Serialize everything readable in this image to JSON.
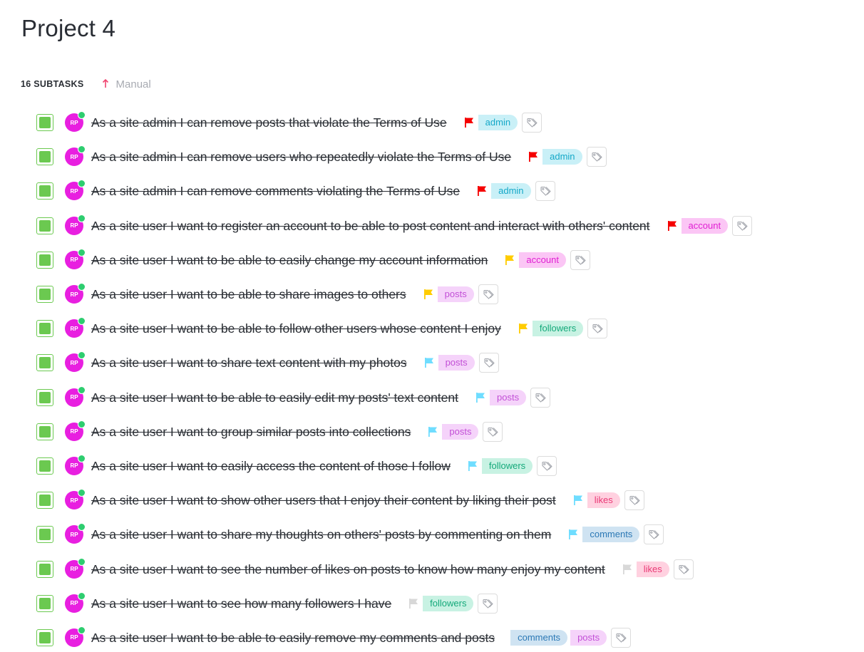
{
  "project": {
    "title": "Project 4"
  },
  "subtasks": {
    "count_label": "16 SUBTASKS",
    "sort_label": "Manual"
  },
  "avatar_initials": "RP",
  "colors": {
    "complete_green": "#6bc950",
    "avatar_magenta": "#e81fe0",
    "presence_green": "#2ecd6f",
    "flag_urgent": "#f50000",
    "flag_high": "#ffcc00",
    "flag_normal": "#6fddff",
    "flag_low": "#d8d8d8"
  },
  "tag_styles": {
    "admin": {
      "bg": "#c9f0f7",
      "fg": "#14a8c8"
    },
    "account": {
      "bg": "#fbc6f5",
      "fg": "#e01fd2"
    },
    "posts": {
      "bg": "#f5d3fa",
      "fg": "#c24fd6"
    },
    "followers": {
      "bg": "#c8f2e3",
      "fg": "#14a97a"
    },
    "likes": {
      "bg": "#ffd1e0",
      "fg": "#ea3a76"
    },
    "comments": {
      "bg": "#cfe3f2",
      "fg": "#2b78b5"
    }
  },
  "tasks": [
    {
      "name": "As a site admin I can remove posts that violate the Terms of Use",
      "priority": "urgent",
      "tags": [
        "admin"
      ]
    },
    {
      "name": "As a site admin I can remove users who repeatedly violate the Terms of Use",
      "priority": "urgent",
      "tags": [
        "admin"
      ]
    },
    {
      "name": "As a site admin I can remove comments violating the Terms of Use",
      "priority": "urgent",
      "tags": [
        "admin"
      ]
    },
    {
      "name": "As a site user I want to register an account to be able to post content and interact with others' content",
      "priority": "urgent",
      "tags": [
        "account"
      ]
    },
    {
      "name": "As a site user I want to be able to easily change my account information",
      "priority": "high",
      "tags": [
        "account"
      ]
    },
    {
      "name": "As a site user I want to be able to share images to others",
      "priority": "high",
      "tags": [
        "posts"
      ]
    },
    {
      "name": "As a site user I want to be able to follow other users whose content I enjoy",
      "priority": "high",
      "tags": [
        "followers"
      ]
    },
    {
      "name": "As a site user I want to share text content with my photos",
      "priority": "normal",
      "tags": [
        "posts"
      ]
    },
    {
      "name": "As a site user I want to be able to easily edit my posts' text content",
      "priority": "normal",
      "tags": [
        "posts"
      ]
    },
    {
      "name": "As a site user I want to group similar posts into collections",
      "priority": "normal",
      "tags": [
        "posts"
      ]
    },
    {
      "name": "As a site user I want to easily access the content of those I follow",
      "priority": "normal",
      "tags": [
        "followers"
      ]
    },
    {
      "name": "As a site user I want to show other users that I enjoy their content by liking their post",
      "priority": "normal",
      "tags": [
        "likes"
      ]
    },
    {
      "name": "As a site user I want to share my thoughts on others' posts by commenting on them",
      "priority": "normal",
      "tags": [
        "comments"
      ]
    },
    {
      "name": "As a site user I want to see the number of likes on posts to know how many enjoy my content",
      "priority": "low",
      "tags": [
        "likes"
      ]
    },
    {
      "name": "As a site user I want to see how many followers I have",
      "priority": "low",
      "tags": [
        "followers"
      ]
    },
    {
      "name": "As a site user I want to be able to easily remove my comments and posts",
      "priority": "none",
      "tags": [
        "comments",
        "posts"
      ]
    }
  ]
}
